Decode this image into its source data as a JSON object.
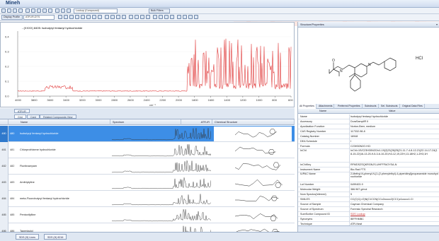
{
  "app": {
    "title": "Mineh"
  },
  "toolbar1": {
    "dropdown_value": "Lookup (Compound)",
    "filter_value": "Bulk Filters"
  },
  "toolbar2": {
    "view_label": "Display Profile",
    "view_value": "ATR-IR-DTS"
  },
  "spectrum": {
    "legend": "- (XXXX) 8405: Isobutyryl fentanyl hydrochloride",
    "x_unit": "cm⁻¹",
    "x_ticks": [
      "4000",
      "3800",
      "3600",
      "3400",
      "3200",
      "3000",
      "2800",
      "2600",
      "2400",
      "2200",
      "2000",
      "1800",
      "1600",
      "1400",
      "1200",
      "1000",
      "800",
      "600"
    ],
    "y_ticks": [
      "0.4",
      "0.3",
      "0.2",
      "0.1",
      "0.0"
    ],
    "line_color": "#e03838"
  },
  "upper_tab": {
    "label": "ATR-IR"
  },
  "view_tabs": [
    "Grid",
    "Card",
    "Related Compounds View"
  ],
  "grid": {
    "columns": [
      "",
      "Name",
      "Spectrum",
      "ATR-IR",
      "Chemical Structure"
    ],
    "rows": [
      {
        "num": "480",
        "id": "480",
        "name": "Isobutyryl fentanyl hydrochloride",
        "selected": true
      },
      {
        "num": "481",
        "id": "481",
        "name": "Chlorprothixene hydrochloride",
        "selected": false
      },
      {
        "num": "482",
        "id": "482",
        "name": "Flunitrazepam",
        "selected": false
      },
      {
        "num": "483",
        "id": "483",
        "name": "Amitriptyline",
        "selected": false
      },
      {
        "num": "484",
        "id": "484",
        "name": "meta-Fluorobutyryl fentanyl hydrochloride",
        "selected": false
      },
      {
        "num": "485",
        "id": "485",
        "name": "Pentoxifylline",
        "selected": false
      },
      {
        "num": "486",
        "id": "486",
        "name": "Tapentadol",
        "selected": false
      }
    ]
  },
  "status_tabs": [
    "SDS (H) Lines",
    "SDS (H) 8216"
  ],
  "right_panel": {
    "title": "Structure/Properties",
    "close": "▾",
    "hcl_label": "HCl",
    "atom_o": "O",
    "atom_n1": "N",
    "atom_n2": "N",
    "tabs": [
      "All Properties",
      "Attachments",
      "Preferred Properties",
      "Substructs",
      "Sel. Substructs",
      "Original Data Files"
    ],
    "col_name": "Name",
    "col_value": "Value",
    "props": [
      {
        "name": "Name",
        "value": "Isobutyryl fentanyl hydrochloride"
      },
      {
        "name": "Accessory",
        "value": "DuraSamplIR II"
      },
      {
        "name": "Apodization Function",
        "value": "Norton-Beer, medium"
      },
      {
        "name": "CAS Registry Number",
        "value": "117332-98-8"
      },
      {
        "name": "Catalog Number",
        "value": "16948"
      },
      {
        "name": "DEA Schedule",
        "value": "I"
      },
      {
        "name": "Formula",
        "value": "C23H30N2O.HCl"
      },
      {
        "name": "InChI",
        "value": "InChI=1S/C23H30N2O/c1-19(2)23(26)25(21-11-7-4-8-12-21)22-14-17-24(18-15-22)16-13-20-9-5-3-6-10-20;/h3-12,19,22H,13-18H2,1-2H3;1H"
      },
      {
        "name": "InChIKey",
        "value": "RFMDSZSQKRGNJS-UHFFFAOYSA-N"
      },
      {
        "name": "Instrument Name",
        "value": "Bio-Rad FTS"
      },
      {
        "name": "IUPAC Name",
        "value": "2-Methyl-N-phenyl-N-[1-(2-phenylethyl)-4-piperidinyl]propanamide monohydrochloride"
      },
      {
        "name": "Lot Number",
        "value": "0499403-9"
      },
      {
        "name": "Molecular Weight",
        "value": "386.967 g/mol"
      },
      {
        "name": "Num Spectra(Inferred)",
        "value": "5"
      },
      {
        "name": "SMILES",
        "value": "CC(C)C(=O)N(C1CCN(CCc2ccccc2)CC1)c1ccccc1.Cl"
      },
      {
        "name": "Source of Sample",
        "value": "Cayman Chemical Company"
      },
      {
        "name": "Source of Spectrum",
        "value": "Forensic Spectral Research"
      },
      {
        "name": "SureScribe Compound ID",
        "value": "SDS Lookup",
        "link": true
      },
      {
        "name": "Synonyms",
        "value": "IBFFHMBC"
      },
      {
        "name": "Technique",
        "value": "ATR-Neat"
      }
    ]
  }
}
